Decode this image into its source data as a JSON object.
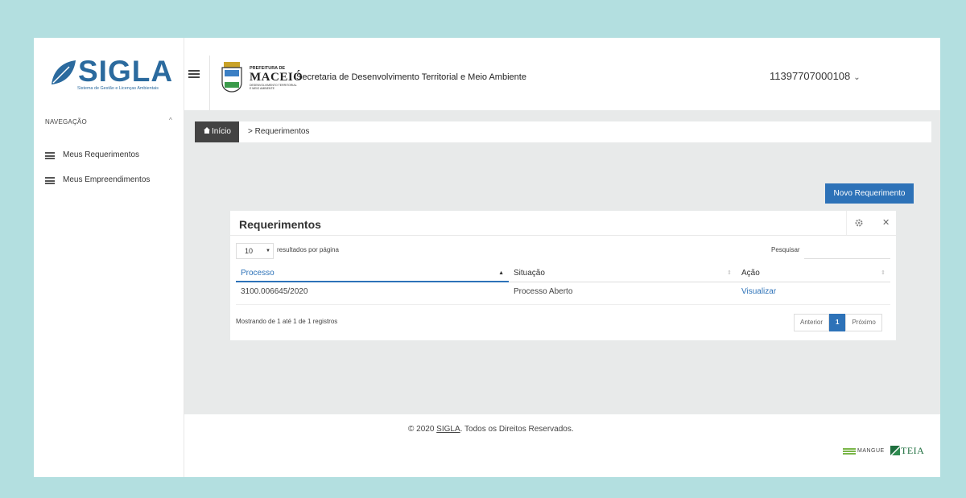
{
  "brand": {
    "name": "SIGLA",
    "subtitle": "Sistema de Gestão e Licenças Ambientais"
  },
  "header": {
    "city_prefix": "PREFEITURA DE",
    "city_name": "MACEIÓ",
    "city_sub": "DESENVOLVIMENTO TERRITORIAL E MEIO AMBIENTE",
    "secretariat": "Secretaria de Desenvolvimento Territorial e Meio Ambiente",
    "user": "11397707000108",
    "user_chevron": "⌄"
  },
  "sidebar": {
    "heading": "NAVEGAÇÃO",
    "collapse_glyph": "^",
    "items": [
      {
        "label": "Meus Requerimentos",
        "icon": "list-icon"
      },
      {
        "label": "Meus Empreendimentos",
        "icon": "list-icon"
      }
    ]
  },
  "breadcrumb": {
    "home": "Início",
    "current": "> Requerimentos"
  },
  "actions": {
    "new_label": "Novo Requerimento"
  },
  "panel": {
    "title": "Requerimentos",
    "page_length": "10",
    "page_length_label": "resultados por página",
    "search_label": "Pesquisar",
    "search_value": "",
    "columns": [
      "Processo",
      "Situação",
      "Ação"
    ],
    "rows": [
      {
        "processo": "3100.006645/2020",
        "situacao": "Processo Aberto",
        "acao": "Visualizar"
      }
    ],
    "info": "Mostrando de 1 até 1 de 1 registros",
    "pager": {
      "prev": "Anterior",
      "current": "1",
      "next": "Próximo"
    }
  },
  "footer": {
    "copyright_pre": "© 2020 ",
    "copyright_brand": "SIGLA",
    "copyright_post": ". Todos os Direitos Reservados.",
    "partner1": "MANGUE",
    "partner2": "TEIA"
  },
  "colors": {
    "accent": "#2d72b8",
    "background": "#b3dfe0",
    "content_bg": "#e8eaea",
    "breadcrumb_home": "#434343"
  }
}
